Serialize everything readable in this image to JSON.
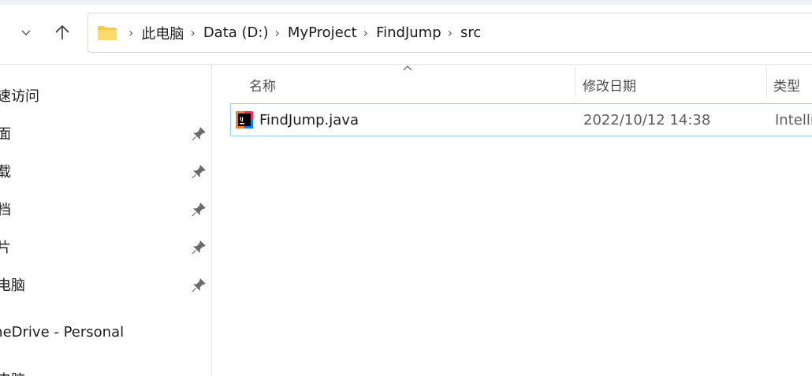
{
  "toolbar": {
    "recent_icon": "chevron-down-icon",
    "up_icon": "arrow-up-icon"
  },
  "address": {
    "icon": "folder-icon",
    "crumbs": [
      "此电脑",
      "Data (D:)",
      "MyProject",
      "FindJump",
      "src"
    ]
  },
  "sidebar": {
    "items": [
      {
        "label": "快速访问",
        "pinned": false
      },
      {
        "label": "桌面",
        "pinned": true
      },
      {
        "label": "下载",
        "pinned": true
      },
      {
        "label": "文档",
        "pinned": true
      },
      {
        "label": "图片",
        "pinned": true
      },
      {
        "label": "此电脑",
        "pinned": true
      },
      {
        "label": "OneDrive - Personal",
        "pinned": false
      },
      {
        "label": "此电脑",
        "pinned": false
      }
    ]
  },
  "list": {
    "columns": [
      "名称",
      "修改日期",
      "类型"
    ],
    "files": [
      {
        "name": "FindJump.java",
        "modified": "2022/10/12 14:38",
        "type": "IntelliJ IDEA",
        "icon": "intellij-java-file-icon"
      }
    ]
  },
  "colors": {
    "selection_border": "#99d1f0",
    "folder": "#f7c948"
  }
}
